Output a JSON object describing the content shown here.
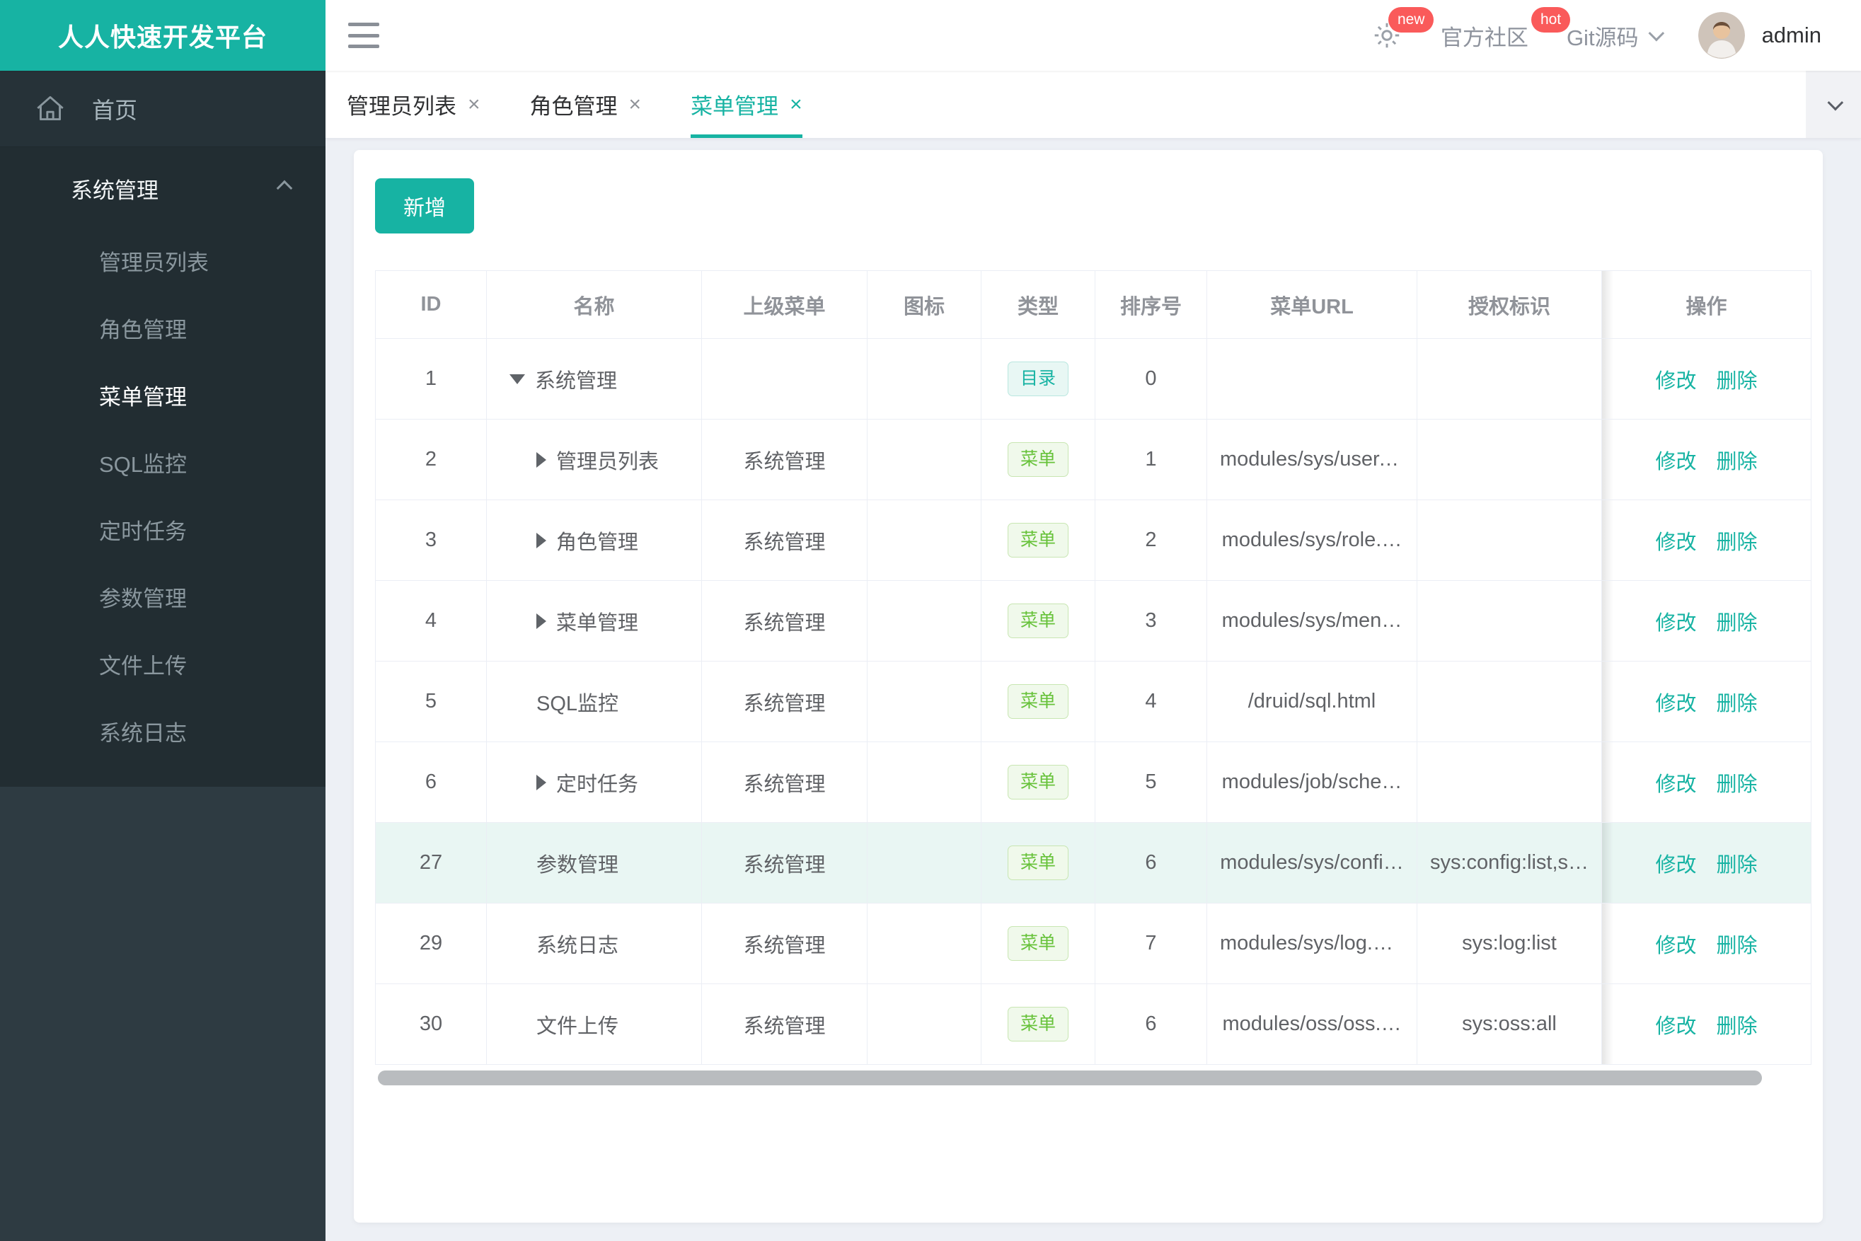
{
  "brand": {
    "title": "人人快速开发平台",
    "color": "#17b3a3"
  },
  "header": {
    "badge_new": "new",
    "community_label": "官方社区",
    "badge_hot": "hot",
    "git_label": "Git源码",
    "username": "admin"
  },
  "sidebar": {
    "home_label": "首页",
    "group_label": "系统管理",
    "items": [
      {
        "label": "管理员列表",
        "active": false
      },
      {
        "label": "角色管理",
        "active": false
      },
      {
        "label": "菜单管理",
        "active": true
      },
      {
        "label": "SQL监控",
        "active": false
      },
      {
        "label": "定时任务",
        "active": false
      },
      {
        "label": "参数管理",
        "active": false
      },
      {
        "label": "文件上传",
        "active": false
      },
      {
        "label": "系统日志",
        "active": false
      }
    ]
  },
  "tabs": [
    {
      "label": "管理员列表",
      "close": "×",
      "active": false
    },
    {
      "label": "角色管理",
      "close": "×",
      "active": false
    },
    {
      "label": "菜单管理",
      "close": "×",
      "active": true
    }
  ],
  "toolbar": {
    "add_label": "新增"
  },
  "table": {
    "headers": [
      "ID",
      "名称",
      "上级菜单",
      "图标",
      "类型",
      "排序号",
      "菜单URL",
      "授权标识",
      "操作"
    ],
    "actions": {
      "edit": "修改",
      "delete": "删除"
    },
    "rows": [
      {
        "id": "1",
        "name": "系统管理",
        "arrow": "down",
        "level": 1,
        "parent": "",
        "type_label": "目录",
        "type_kind": "dir",
        "order": "0",
        "url": "",
        "perms": "",
        "highlight": false
      },
      {
        "id": "2",
        "name": "管理员列表",
        "arrow": "right",
        "level": 2,
        "parent": "系统管理",
        "type_label": "菜单",
        "type_kind": "menu",
        "order": "1",
        "url": "modules/sys/user.…",
        "perms": "",
        "highlight": false
      },
      {
        "id": "3",
        "name": "角色管理",
        "arrow": "right",
        "level": 2,
        "parent": "系统管理",
        "type_label": "菜单",
        "type_kind": "menu",
        "order": "2",
        "url": "modules/sys/role.…",
        "perms": "",
        "highlight": false
      },
      {
        "id": "4",
        "name": "菜单管理",
        "arrow": "right",
        "level": 2,
        "parent": "系统管理",
        "type_label": "菜单",
        "type_kind": "menu",
        "order": "3",
        "url": "modules/sys/men…",
        "perms": "",
        "highlight": false
      },
      {
        "id": "5",
        "name": "SQL监控",
        "arrow": "none",
        "level": 2,
        "parent": "系统管理",
        "type_label": "菜单",
        "type_kind": "menu",
        "order": "4",
        "url": "/druid/sql.html",
        "perms": "",
        "highlight": false
      },
      {
        "id": "6",
        "name": "定时任务",
        "arrow": "right",
        "level": 2,
        "parent": "系统管理",
        "type_label": "菜单",
        "type_kind": "menu",
        "order": "5",
        "url": "modules/job/sche…",
        "perms": "",
        "highlight": false
      },
      {
        "id": "27",
        "name": "参数管理",
        "arrow": "none",
        "level": 2,
        "parent": "系统管理",
        "type_label": "菜单",
        "type_kind": "menu",
        "order": "6",
        "url": "modules/sys/confi…",
        "perms": "sys:config:list,sys:…",
        "highlight": true
      },
      {
        "id": "29",
        "name": "系统日志",
        "arrow": "none",
        "level": 2,
        "parent": "系统管理",
        "type_label": "菜单",
        "type_kind": "menu",
        "order": "7",
        "url": "modules/sys/log.h…",
        "perms": "sys:log:list",
        "highlight": false
      },
      {
        "id": "30",
        "name": "文件上传",
        "arrow": "none",
        "level": 2,
        "parent": "系统管理",
        "type_label": "菜单",
        "type_kind": "menu",
        "order": "6",
        "url": "modules/oss/oss.…",
        "perms": "sys:oss:all",
        "highlight": false
      }
    ]
  }
}
